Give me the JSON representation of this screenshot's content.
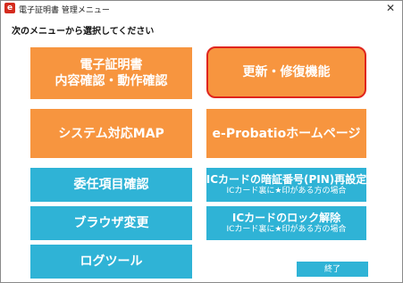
{
  "window": {
    "title": "電子証明書 管理メニュー",
    "app_icon": "e",
    "close_label": "✕"
  },
  "instruction": "次のメニューから選択してください",
  "menu": {
    "cert_check": {
      "line1": "電子証明書",
      "line2": "内容確認・動作確認"
    },
    "renew_repair": {
      "label": "更新・修復機能"
    },
    "system_map": {
      "label": "システム対応MAP"
    },
    "homepage": {
      "label": "e-Probatioホームページ"
    },
    "delegation": {
      "label": "委任項目確認"
    },
    "pin_reset": {
      "label": "ICカードの暗証番号(PIN)再設定",
      "note": "ICカード裏に★印がある方の場合"
    },
    "browser_change": {
      "label": "ブラウザ変更"
    },
    "card_unlock": {
      "label": "ICカードのロック解除",
      "note": "ICカード裏に★印がある方の場合"
    },
    "log_tool": {
      "label": "ログツール"
    },
    "exit": {
      "label": "終了"
    }
  },
  "colors": {
    "orange": "#f7953f",
    "blue": "#2fb3d6",
    "highlight_border": "#e0251d"
  }
}
